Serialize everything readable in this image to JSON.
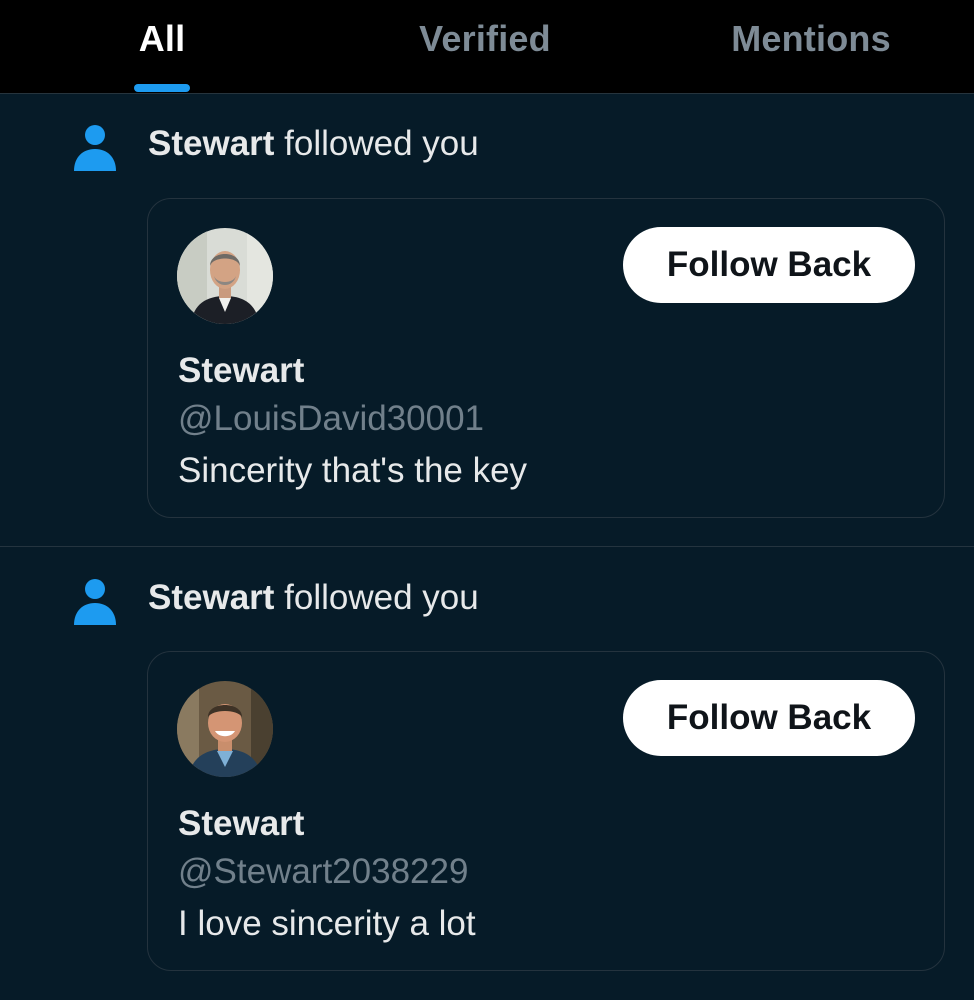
{
  "tabs": [
    {
      "label": "All",
      "active": true
    },
    {
      "label": "Verified",
      "active": false
    },
    {
      "label": "Mentions",
      "active": false
    }
  ],
  "colors": {
    "background": "#061b28",
    "tab_bar": "#000000",
    "accent": "#1d9bf0",
    "text_primary": "#e7e9ea",
    "text_secondary": "#71808b",
    "button_bg": "#ffffff",
    "button_text": "#0f1419"
  },
  "notifications": [
    {
      "icon": "person-icon",
      "actor": "Stewart",
      "action": "followed you",
      "card": {
        "avatar": "profile-photo",
        "button_label": "Follow Back",
        "name": "Stewart",
        "handle": "@LouisDavid30001",
        "bio": "Sincerity that's the key"
      }
    },
    {
      "icon": "person-icon",
      "actor": "Stewart",
      "action": "followed you",
      "card": {
        "avatar": "profile-photo",
        "button_label": "Follow Back",
        "name": "Stewart",
        "handle": "@Stewart2038229",
        "bio": "I love sincerity a lot"
      }
    }
  ]
}
